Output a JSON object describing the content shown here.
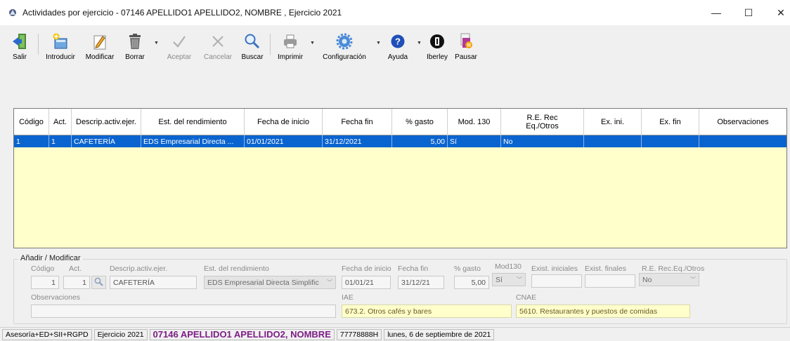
{
  "window": {
    "title": "Actividades por ejercicio - 07146 APELLIDO1 APELLIDO2, NOMBRE , Ejercicio 2021",
    "min_glyph": "—",
    "max_glyph": "☐",
    "close_glyph": "✕"
  },
  "toolbar": {
    "buttons": [
      {
        "label": "Salir",
        "icon": "exit-icon"
      },
      {
        "label": "Introducir",
        "icon": "add-record-icon"
      },
      {
        "label": "Modificar",
        "icon": "edit-icon"
      },
      {
        "label": "Borrar",
        "icon": "trash-icon"
      },
      {
        "label": "Aceptar",
        "icon": "check-icon",
        "disabled": true
      },
      {
        "label": "Cancelar",
        "icon": "cancel-icon",
        "disabled": true
      },
      {
        "label": "Buscar",
        "icon": "search-icon"
      },
      {
        "label": "Imprimir",
        "icon": "printer-icon"
      },
      {
        "label": "Configuración",
        "icon": "gear-icon"
      },
      {
        "label": "Ayuda",
        "icon": "help-icon"
      },
      {
        "label": "Iberley",
        "icon": "iberley-icon"
      },
      {
        "label": "Pausar",
        "icon": "pause-icon"
      }
    ]
  },
  "grid": {
    "columns": [
      "Código",
      "Act.",
      "Descrip.activ.ejer.",
      "Est. del rendimiento",
      "Fecha de inicio",
      "Fecha fin",
      "% gasto",
      "Mod. 130",
      "R.E. Rec\nEq./Otros",
      "Ex. ini.",
      "Ex. fin",
      "Observaciones"
    ],
    "rows": [
      [
        "1",
        "1",
        "CAFETERÍA",
        "EDS Empresarial Directa ...",
        "01/01/2021",
        "31/12/2021",
        "5,00",
        "Sí",
        "No",
        "",
        "",
        ""
      ]
    ]
  },
  "form": {
    "group_title": "Añadir / Modificar",
    "labels": {
      "codigo": "Código",
      "act": "Act.",
      "descrip": "Descrip.activ.ejer.",
      "est": "Est. del rendimiento",
      "fecha_inicio": "Fecha de inicio",
      "fecha_fin": "Fecha fin",
      "gasto": "% gasto",
      "mod130": "Mod130",
      "exist_ini": "Exist. iniciales",
      "exist_fin": "Exist. finales",
      "re_rec": "R.E. Rec.Eq./Otros",
      "observaciones": "Observaciones",
      "iae": "IAE",
      "cnae": "CNAE"
    },
    "values": {
      "codigo": "1",
      "act": "1",
      "descrip": "CAFETERÍA",
      "est": "EDS Empresarial Directa Simplific",
      "fecha_inicio": "01/01/21",
      "fecha_fin": "31/12/21",
      "gasto": "5,00",
      "mod130": "Sí",
      "exist_ini": "",
      "exist_fin": "",
      "re_rec": "No",
      "observaciones": "",
      "iae": "673.2. Otros cafés y bares",
      "cnae": "5610. Restaurantes y puestos de comidas"
    }
  },
  "statusbar": {
    "module": "Asesoría+ED+SII+RGPD",
    "ejercicio": "Ejercicio 2021",
    "client": "07146 APELLIDO1 APELLIDO2, NOMBRE",
    "nif": "77778888H",
    "date": "lunes, 6 de septiembre de 2021"
  },
  "colors": {
    "selection": "#0a64d0",
    "grid_background": "#ffffcc",
    "client_text": "#7d1e86"
  }
}
